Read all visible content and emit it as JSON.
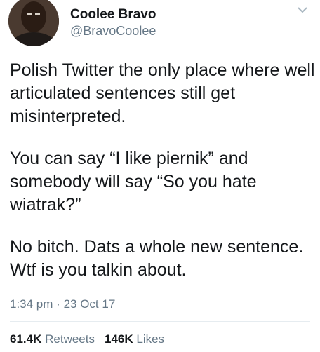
{
  "user": {
    "display_name": "Coolee Bravo",
    "handle": "@BravoCoolee"
  },
  "tweet": {
    "paragraphs": [
      "Polish Twitter the only place where well articulated sentences still get misinterpreted.",
      "You can say “I like piernik” and somebody will say “So you hate wiatrak?”",
      "No bitch. Dats a whole new sentence. Wtf is you talkin about."
    ],
    "time": "1:34 pm",
    "date": "23 Oct 17",
    "separator": "·"
  },
  "stats": {
    "retweets_count": "61.4K",
    "retweets_label": "Retweets",
    "likes_count": "146K",
    "likes_label": "Likes"
  },
  "icons": {
    "menu": "chevron-down-icon"
  }
}
